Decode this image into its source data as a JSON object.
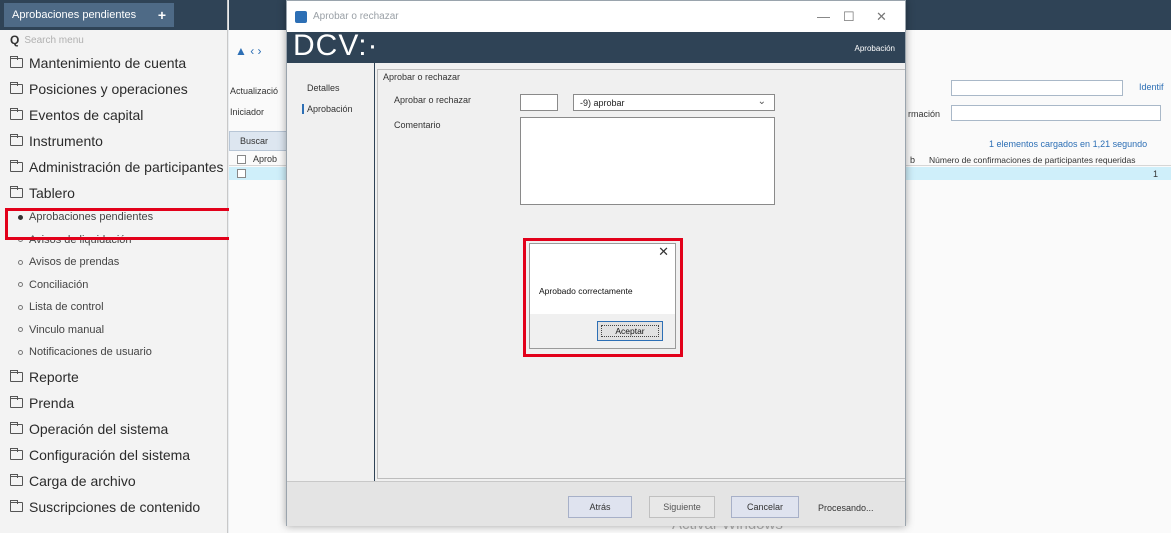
{
  "left_panel": {
    "tab_label": "Aprobaciones pendientes",
    "tab_add": "+",
    "search_placeholder": "Search menu",
    "menu_top": [
      "Mantenimiento de cuenta",
      "Posiciones y operaciones",
      "Eventos de capital",
      "Instrumento",
      "Administración de participantes",
      "Tablero"
    ],
    "submenu": [
      "Aprobaciones pendientes",
      "Avisos de liquidación",
      "Avisos de prendas",
      "Conciliación",
      "Lista de control",
      "Vinculo manual",
      "Notificaciones de usuario"
    ],
    "menu_bottom": [
      "Reporte",
      "Prenda",
      "Operación del sistema",
      "Configuración del sistema",
      "Carga de archivo",
      "Suscripciones de contenido"
    ]
  },
  "background": {
    "tools": "▲ ‹ ›",
    "label_actualizacion": "Actualizació",
    "label_iniciador": "Iniciador",
    "button_buscar": "Buscar",
    "col_aprob": "Aprob",
    "label_identif": "Identif",
    "label_confirmacion": "rmación",
    "loaded_text": "1 elementos cargados en 1,21 segundo",
    "col_b": "b",
    "col_confirmaciones": "Número de confirmaciones de participantes requeridas",
    "row_value": "1",
    "watermark": "Activar Windows"
  },
  "dialog": {
    "title": "Aprobar o rechazar",
    "logo": "DCV:·",
    "banner_right": "Aprobación",
    "nav": [
      "Detalles",
      "Aprobación"
    ],
    "group_label": "Aprobar o rechazar",
    "field_label": "Aprobar o rechazar",
    "select_value": "-9) aprobar",
    "comment_label": "Comentario",
    "buttons": {
      "back": "Atrás",
      "next": "Siguiente",
      "cancel": "Cancelar"
    },
    "processing": "Procesando..."
  },
  "message_box": {
    "text": "Aprobado correctamente",
    "ok": "Aceptar"
  }
}
